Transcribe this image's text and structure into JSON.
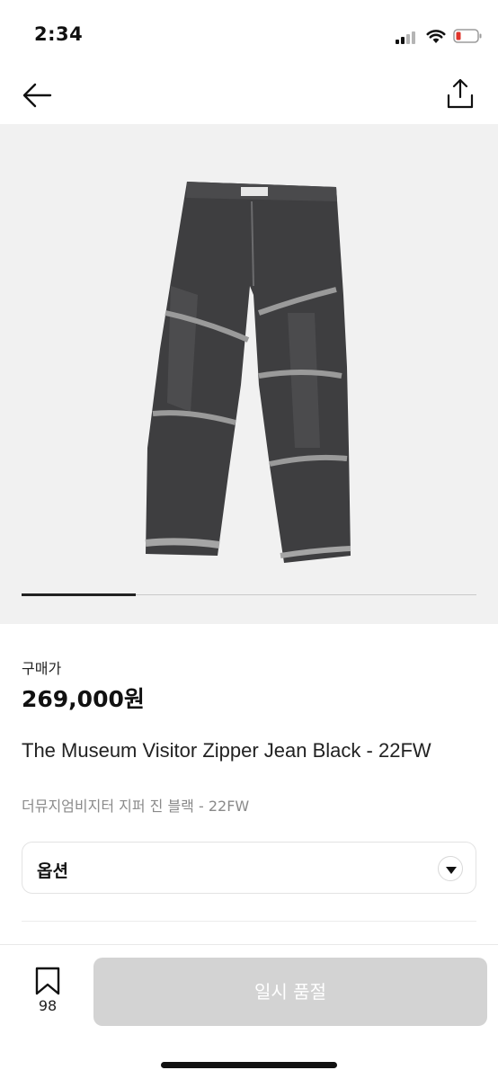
{
  "status_bar": {
    "time": "2:34",
    "battery_color": "#e0352b"
  },
  "nav": {
    "back_icon": "arrow-left-icon",
    "share_icon": "share-icon"
  },
  "gallery": {
    "image_description": "black denim jeans",
    "slide_progress": 0.25
  },
  "product": {
    "price_label": "구매가",
    "price": "269,000원",
    "name_en": "The Museum Visitor Zipper Jean Black - 22FW",
    "name_ko": "더뮤지엄비지터 지퍼 진 블랙 - 22FW"
  },
  "option": {
    "label": "옵션",
    "icon": "chevron-down-icon"
  },
  "bottom_bar": {
    "bookmark_icon": "bookmark-icon",
    "bookmark_count": "98",
    "soldout_label": "일시 품절",
    "button_color": "#d3d3d3"
  }
}
